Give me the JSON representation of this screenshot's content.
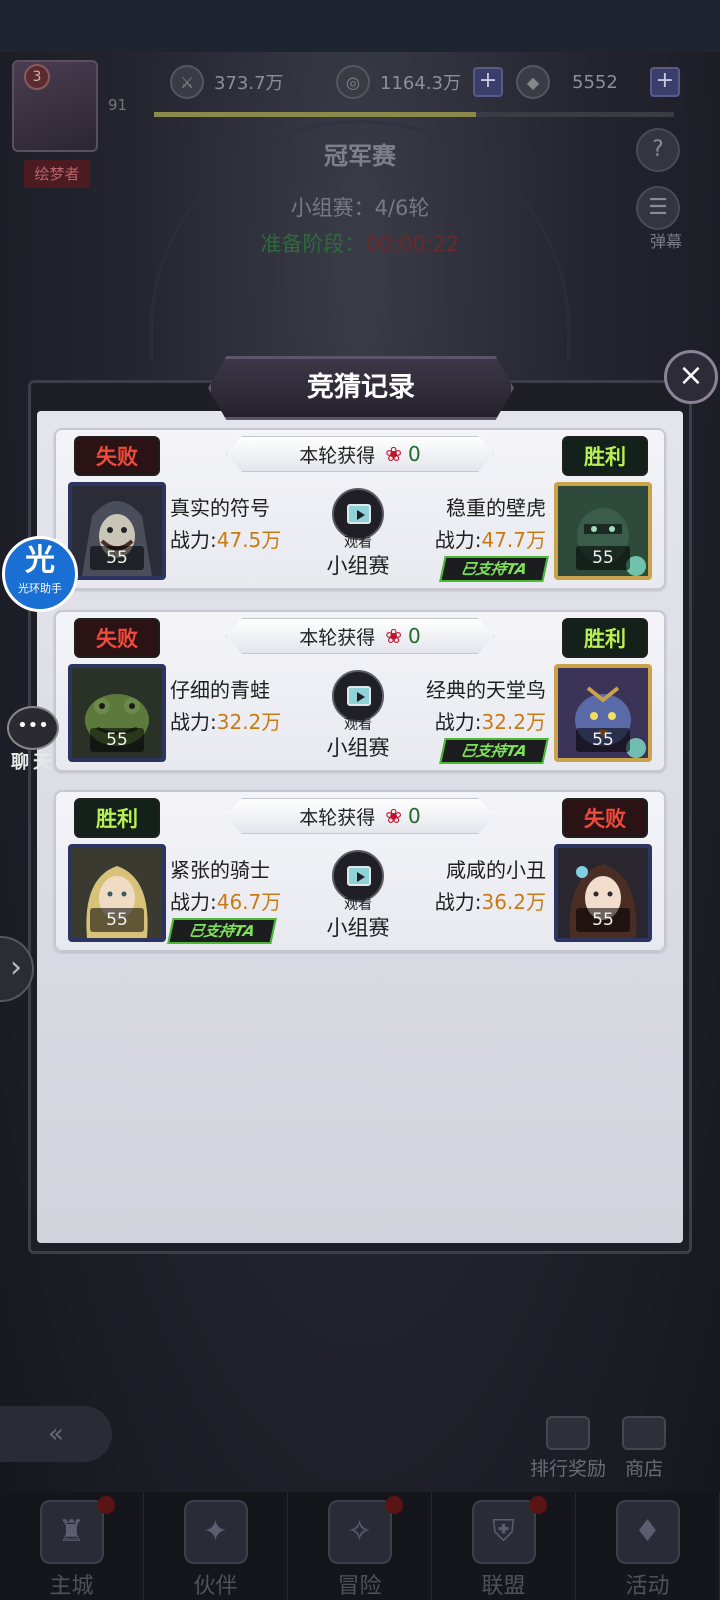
{
  "header": {
    "player_level_badge": "3",
    "player_title": "绘梦者",
    "player_level": "91",
    "power_stat": "373.7万",
    "gold": "1164.3万",
    "diamonds": "5552",
    "plus_symbol": "+",
    "exp_progress": 0.62
  },
  "stage": {
    "title": "冠军赛",
    "round": "小组赛：4/6轮",
    "phase_label": "准备阶段：",
    "phase_time": "00:00:22",
    "help_icon": "?",
    "danmaku_label": "弹幕"
  },
  "floating": {
    "helper_glyph": "光",
    "helper_label": "光环助手",
    "chat_label": "聊天",
    "chat_icon": "•••",
    "expand_icon": "›"
  },
  "modal": {
    "title": "竞猜记录",
    "close_icon": "×",
    "records": [
      {
        "reward_label": "本轮获得",
        "reward_count": "0",
        "left": {
          "result": "失败",
          "name": "真实的符号",
          "power_label": "战力:",
          "power": "47.5万",
          "level": "55"
        },
        "right": {
          "result": "胜利",
          "name": "稳重的壁虎",
          "power_label": "战力:",
          "power": "47.7万",
          "level": "55",
          "supported": "已支持TA"
        },
        "watch_label": "观看",
        "match_type": "小组赛"
      },
      {
        "reward_label": "本轮获得",
        "reward_count": "0",
        "left": {
          "result": "失败",
          "name": "仔细的青蛙",
          "power_label": "战力:",
          "power": "32.2万",
          "level": "55"
        },
        "right": {
          "result": "胜利",
          "name": "经典的天堂鸟",
          "power_label": "战力:",
          "power": "32.2万",
          "level": "55",
          "supported": "已支持TA"
        },
        "watch_label": "观看",
        "match_type": "小组赛"
      },
      {
        "reward_label": "本轮获得",
        "reward_count": "0",
        "left": {
          "result": "胜利",
          "name": "紧张的骑士",
          "power_label": "战力:",
          "power": "46.7万",
          "level": "55",
          "supported": "已支持TA"
        },
        "right": {
          "result": "失败",
          "name": "咸咸的小丑",
          "power_label": "战力:",
          "power": "36.2万",
          "level": "55"
        },
        "watch_label": "观看",
        "match_type": "小组赛"
      }
    ]
  },
  "bottom": {
    "back_icon": "«",
    "ranking_rewards": "排行奖励",
    "shop": "商店",
    "nav": [
      {
        "label": "主城",
        "icon": "♜",
        "dot": true
      },
      {
        "label": "伙伴",
        "icon": "✦",
        "dot": false
      },
      {
        "label": "冒险",
        "icon": "✧",
        "dot": true
      },
      {
        "label": "联盟",
        "icon": "⛨",
        "dot": true
      },
      {
        "label": "活动",
        "icon": "♦",
        "dot": false
      }
    ]
  },
  "colors": {
    "win": "#b8ef52",
    "lose": "#f24a3a",
    "power_value": "#c77b13",
    "supported": "#4bb934"
  }
}
